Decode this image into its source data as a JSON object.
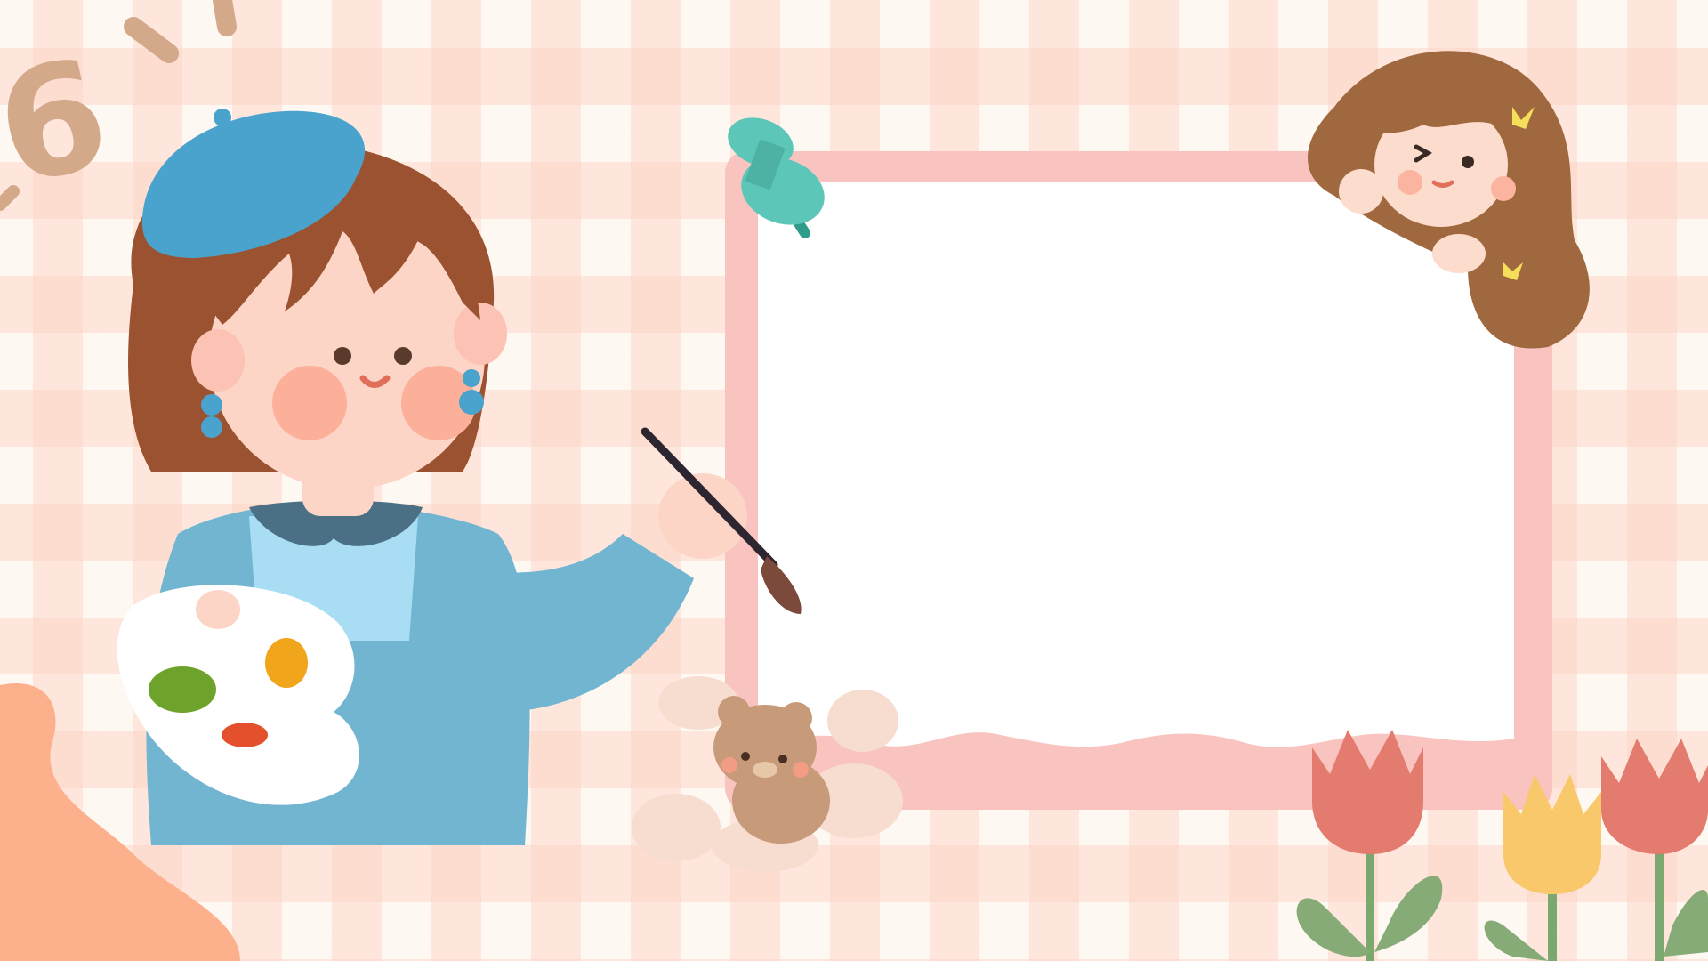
{
  "scene": {
    "background_color": "#fef8f3",
    "check_color": "#fdd6c8",
    "corner_digits": "6",
    "frame_color": "#f9c4c0",
    "frame_inner": "#ffffff",
    "pin_color": "#5cc7b9"
  },
  "icons": [
    "painter-girl-icon",
    "paint-palette-icon",
    "paintbrush-icon",
    "push-pin-icon",
    "curly-hair-girl-icon",
    "teddy-bear-icon",
    "cloud-icon",
    "tulip-icon"
  ]
}
